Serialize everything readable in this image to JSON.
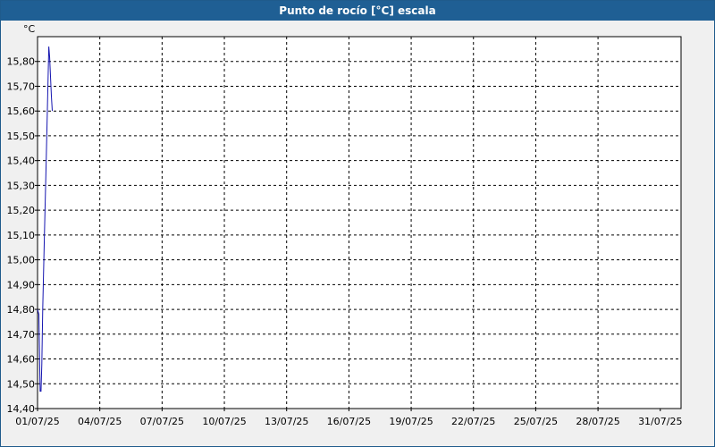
{
  "window": {
    "title": "Punto de rocío [°C] escala"
  },
  "colors": {
    "title_bar": "#1f5f94",
    "series_line": "#1515b0",
    "grid": "#000000",
    "background": "#f0f0f0",
    "plot_area": "#ffffff"
  },
  "chart_data": {
    "type": "line",
    "title": "Punto de rocío [°C] escala",
    "ylabel": "°C",
    "xlabel": "",
    "ylim": [
      14.4,
      15.9
    ],
    "xlim_days": [
      0,
      31
    ],
    "x_tick_labels": [
      "01/07/25",
      "04/07/25",
      "07/07/25",
      "10/07/25",
      "13/07/25",
      "16/07/25",
      "19/07/25",
      "22/07/25",
      "25/07/25",
      "28/07/25",
      "31/07/25"
    ],
    "y_tick_labels": [
      "14,40",
      "14,50",
      "14,60",
      "14,70",
      "14,80",
      "14,90",
      "15,00",
      "15,10",
      "15,20",
      "15,30",
      "15,40",
      "15,50",
      "15,60",
      "15,70",
      "15,80"
    ],
    "grid": true,
    "series": [
      {
        "points": [
          {
            "x": "01/07/25 00:00",
            "y": 14.8
          },
          {
            "x": "01/07/25 01:30",
            "y": 14.78
          },
          {
            "x": "01/07/25 03:00",
            "y": 14.47
          },
          {
            "x": "01/07/25 04:00",
            "y": 14.47
          },
          {
            "x": "01/07/25 05:00",
            "y": 14.58
          },
          {
            "x": "01/07/25 06:00",
            "y": 14.8
          },
          {
            "x": "01/07/25 08:00",
            "y": 15.1
          },
          {
            "x": "01/07/25 10:00",
            "y": 15.4
          },
          {
            "x": "01/07/25 12:00",
            "y": 15.7
          },
          {
            "x": "01/07/25 13:00",
            "y": 15.86
          },
          {
            "x": "01/07/25 14:00",
            "y": 15.82
          },
          {
            "x": "01/07/25 15:00",
            "y": 15.74
          },
          {
            "x": "01/07/25 16:00",
            "y": 15.66
          },
          {
            "x": "01/07/25 17:00",
            "y": 15.6
          }
        ]
      }
    ]
  }
}
